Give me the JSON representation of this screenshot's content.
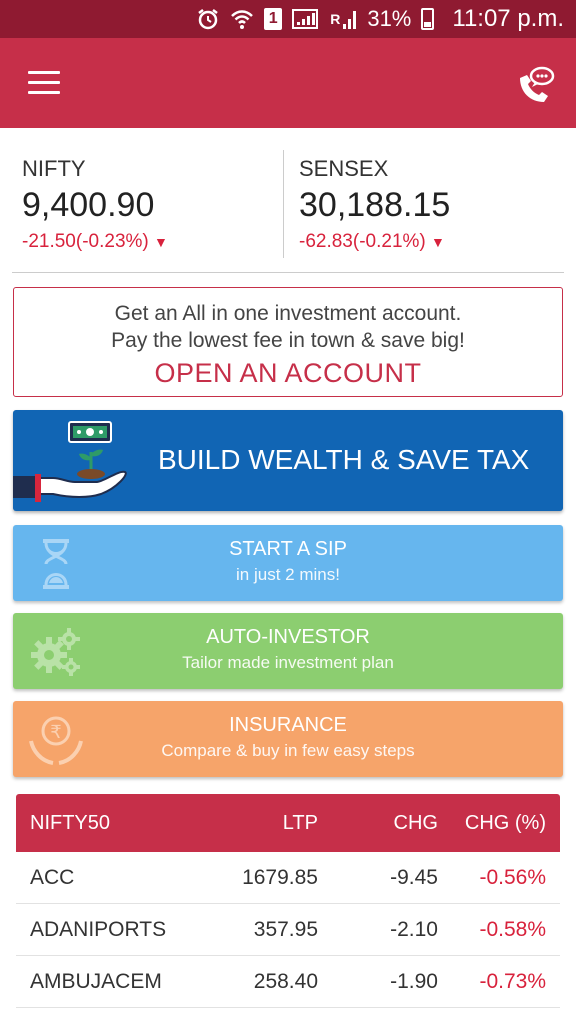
{
  "status_bar": {
    "battery": "31%",
    "time": "11:07 p.m.",
    "sim": "1",
    "network": "R"
  },
  "market": {
    "nifty": {
      "name": "NIFTY",
      "value": "9,400.90",
      "change": "-21.50(-0.23%)"
    },
    "sensex": {
      "name": "SENSEX",
      "value": "30,188.15",
      "change": "-62.83(-0.21%)"
    }
  },
  "open_account": {
    "line1": "Get an All in one investment account.",
    "line2": "Pay the lowest fee in town & save big!",
    "cta": "OPEN AN ACCOUNT"
  },
  "build_wealth": {
    "label": "BUILD WEALTH & SAVE TAX"
  },
  "tiles": {
    "sip": {
      "title": "START A SIP",
      "subtitle": "in just 2 mins!"
    },
    "auto_investor": {
      "title": "AUTO-INVESTOR",
      "subtitle": "Tailor made investment plan"
    },
    "insurance": {
      "title": "INSURANCE",
      "subtitle": "Compare & buy in few easy steps"
    }
  },
  "nifty_table": {
    "headers": [
      "NIFTY50",
      "LTP",
      "CHG",
      "CHG (%)"
    ],
    "rows": [
      {
        "symbol": "ACC",
        "ltp": "1679.85",
        "chg": "-9.45",
        "chg_pct": "-0.56%"
      },
      {
        "symbol": "ADANIPORTS",
        "ltp": "357.95",
        "chg": "-2.10",
        "chg_pct": "-0.58%"
      },
      {
        "symbol": "AMBUJACEM",
        "ltp": "258.40",
        "chg": "-1.90",
        "chg_pct": "-0.73%"
      }
    ]
  },
  "colors": {
    "brand": "#c62f49",
    "status_bar": "#8f1a31",
    "negative": "#d8223c",
    "build_wealth": "#1165b4",
    "sip": "#66b6ee",
    "auto_investor": "#8cce70",
    "insurance": "#f6a46a"
  },
  "icons": {
    "menu": "hamburger-menu-icon",
    "call": "phone-chat-icon",
    "down": "caret-down-icon",
    "sip": "hourglass-icon",
    "auto": "gears-icon",
    "insurance": "rupee-hands-icon",
    "wealth": "money-hand-plant-icon"
  }
}
